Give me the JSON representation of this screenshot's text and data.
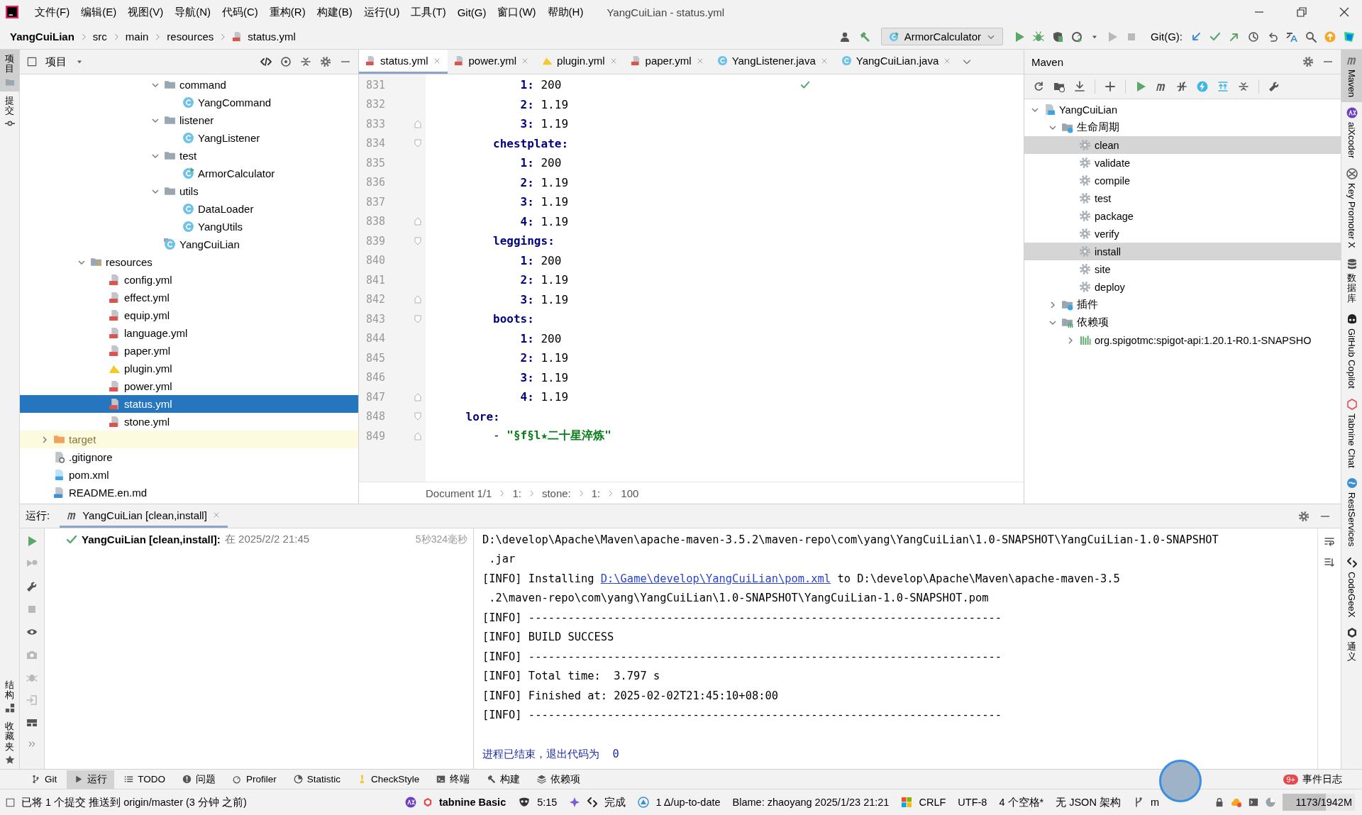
{
  "menu_bar": {
    "items": [
      "文件(F)",
      "编辑(E)",
      "视图(V)",
      "导航(N)",
      "代码(C)",
      "重构(R)",
      "构建(B)",
      "运行(U)",
      "工具(T)",
      "Git(G)",
      "窗口(W)",
      "帮助(H)"
    ],
    "title": "YangCuiLian - status.yml"
  },
  "breadcrumb": [
    {
      "label": "YangCuiLian",
      "kind": "project"
    },
    {
      "label": "src",
      "kind": "folder"
    },
    {
      "label": "main",
      "kind": "folder"
    },
    {
      "label": "resources",
      "kind": "folder"
    },
    {
      "label": "status.yml",
      "kind": "yml"
    }
  ],
  "toolbar": {
    "run_config": "ArmorCalculator",
    "git_label": "Git(G):"
  },
  "left_strip_top": [
    {
      "label": "项目",
      "kind": "project",
      "selected": true
    },
    {
      "label": "提交",
      "kind": "commit",
      "selected": false
    }
  ],
  "left_strip_bottom": [
    {
      "label": "结构",
      "kind": "structure",
      "selected": false
    },
    {
      "label": "收藏夹",
      "kind": "favorites",
      "selected": false
    }
  ],
  "project": {
    "title": "项目",
    "tree": [
      {
        "children": [
          {
            "children": [
              {
                "children": [
                  {
                    "children": [
                      {
                        "children": [
                          {
                            "children": [
                              {
                                "label": "command",
                                "kind": "folder",
                                "expanded": true,
                                "selected": false,
                                "children": [
                                  {
                                    "label": "YangCommand",
                                    "kind": "class",
                                    "selected": false
                                  }
                                ]
                              },
                              {
                                "label": "listener",
                                "kind": "folder",
                                "expanded": true,
                                "selected": false,
                                "children": [
                                  {
                                    "label": "YangListener",
                                    "kind": "class",
                                    "selected": false
                                  }
                                ]
                              },
                              {
                                "label": "test",
                                "kind": "folder",
                                "expanded": true,
                                "selected": false,
                                "children": [
                                  {
                                    "label": "ArmorCalculator",
                                    "kind": "class-runnable",
                                    "selected": false
                                  }
                                ]
                              },
                              {
                                "label": "utils",
                                "kind": "folder",
                                "expanded": true,
                                "selected": false,
                                "children": [
                                  {
                                    "label": "DataLoader",
                                    "kind": "class",
                                    "selected": false
                                  },
                                  {
                                    "label": "YangUtils",
                                    "kind": "class",
                                    "selected": false
                                  }
                                ]
                              },
                              {
                                "label": "YangCuiLian",
                                "kind": "class-main",
                                "selected": false
                              }
                            ]
                          }
                        ]
                      }
                    ]
                  }
                ]
              },
              {
                "label": "resources",
                "kind": "resources-folder",
                "expanded": true,
                "selected": false,
                "children": [
                  {
                    "label": "config.yml",
                    "kind": "yml",
                    "selected": false
                  },
                  {
                    "label": "effect.yml",
                    "kind": "yml",
                    "selected": false
                  },
                  {
                    "label": "equip.yml",
                    "kind": "yml",
                    "selected": false
                  },
                  {
                    "label": "language.yml",
                    "kind": "yml",
                    "selected": false
                  },
                  {
                    "label": "paper.yml",
                    "kind": "yml",
                    "selected": false
                  },
                  {
                    "label": "plugin.yml",
                    "kind": "plugin-yml",
                    "selected": false
                  },
                  {
                    "label": "power.yml",
                    "kind": "yml",
                    "selected": false
                  },
                  {
                    "label": "status.yml",
                    "kind": "yml",
                    "selected": true
                  },
                  {
                    "label": "stone.yml",
                    "kind": "yml",
                    "selected": false
                  }
                ]
              }
            ]
          }
        ]
      },
      {
        "label": "target",
        "kind": "excluded-folder",
        "expanded": false,
        "selected": false
      },
      {
        "label": ".gitignore",
        "kind": "gitignore",
        "selected": false
      },
      {
        "label": "pom.xml",
        "kind": "maven-file",
        "selected": false
      },
      {
        "label": "README.en.md",
        "kind": "markdown",
        "selected": false
      }
    ]
  },
  "editor": {
    "tabs": [
      {
        "label": "status.yml",
        "kind": "yml",
        "selected": true
      },
      {
        "label": "power.yml",
        "kind": "yml",
        "selected": false
      },
      {
        "label": "plugin.yml",
        "kind": "plugin-yml",
        "selected": false
      },
      {
        "label": "paper.yml",
        "kind": "yml",
        "selected": false
      },
      {
        "label": "YangListener.java",
        "kind": "class",
        "selected": false
      },
      {
        "label": "YangCuiLian.java",
        "kind": "class",
        "selected": false
      }
    ],
    "lines": [
      {
        "number": "831",
        "kind": "entry",
        "key": "            1:",
        "value": "200",
        "fold_start": false,
        "fold_end": false
      },
      {
        "number": "832",
        "kind": "entry",
        "key": "            2:",
        "value": "1.19",
        "fold_start": false,
        "fold_end": false
      },
      {
        "number": "833",
        "kind": "entry",
        "key": "            3:",
        "value": "1.19",
        "fold_start": false,
        "fold_end": true
      },
      {
        "number": "834",
        "kind": "section",
        "key": "        chestplate:",
        "fold_start": true,
        "fold_end": false
      },
      {
        "number": "835",
        "kind": "entry",
        "key": "            1:",
        "value": "200",
        "fold_start": false,
        "fold_end": false
      },
      {
        "number": "836",
        "kind": "entry",
        "key": "            2:",
        "value": "1.19",
        "fold_start": false,
        "fold_end": false
      },
      {
        "number": "837",
        "kind": "entry",
        "key": "            3:",
        "value": "1.19",
        "fold_start": false,
        "fold_end": false
      },
      {
        "number": "838",
        "kind": "entry",
        "key": "            4:",
        "value": "1.19",
        "fold_start": false,
        "fold_end": true
      },
      {
        "number": "839",
        "kind": "section",
        "key": "        leggings:",
        "fold_start": true,
        "fold_end": false
      },
      {
        "number": "840",
        "kind": "entry",
        "key": "            1:",
        "value": "200",
        "fold_start": false,
        "fold_end": false
      },
      {
        "number": "841",
        "kind": "entry",
        "key": "            2:",
        "value": "1.19",
        "fold_start": false,
        "fold_end": false
      },
      {
        "number": "842",
        "kind": "entry",
        "key": "            3:",
        "value": "1.19",
        "fold_start": false,
        "fold_end": true
      },
      {
        "number": "843",
        "kind": "section",
        "key": "        boots:",
        "fold_start": true,
        "fold_end": false
      },
      {
        "number": "844",
        "kind": "entry",
        "key": "            1:",
        "value": "200",
        "fold_start": false,
        "fold_end": false
      },
      {
        "number": "845",
        "kind": "entry",
        "key": "            2:",
        "value": "1.19",
        "fold_start": false,
        "fold_end": false
      },
      {
        "number": "846",
        "kind": "entry",
        "key": "            3:",
        "value": "1.19",
        "fold_start": false,
        "fold_end": false
      },
      {
        "number": "847",
        "kind": "entry",
        "key": "            4:",
        "value": "1.19",
        "fold_start": false,
        "fold_end": true
      },
      {
        "number": "848",
        "kind": "section",
        "key": "    lore:",
        "fold_start": true,
        "fold_end": false
      },
      {
        "number": "849",
        "kind": "list-item",
        "key": "        -",
        "value": "\"§f§l★二十星淬炼\"",
        "fold_start": false,
        "fold_end": true
      }
    ],
    "breadcrumb": [
      "Document 1/1",
      "1:",
      "stone:",
      "1:",
      "100"
    ]
  },
  "maven": {
    "title": "Maven",
    "tree": [
      {
        "label": "YangCuiLian",
        "kind": "project",
        "expanded": true,
        "selected": false,
        "children": [
          {
            "label": "生命周期",
            "kind": "lifecycle",
            "expanded": true,
            "selected": false,
            "children": [
              {
                "label": "clean",
                "kind": "goal",
                "selected": true
              },
              {
                "label": "validate",
                "kind": "goal",
                "selected": false
              },
              {
                "label": "compile",
                "kind": "goal",
                "selected": false
              },
              {
                "label": "test",
                "kind": "goal",
                "selected": false
              },
              {
                "label": "package",
                "kind": "goal",
                "selected": false
              },
              {
                "label": "verify",
                "kind": "goal",
                "selected": false
              },
              {
                "label": "install",
                "kind": "goal",
                "selected": true
              },
              {
                "label": "site",
                "kind": "goal",
                "selected": false
              },
              {
                "label": "deploy",
                "kind": "goal",
                "selected": false
              }
            ]
          },
          {
            "label": "插件",
            "kind": "plugins",
            "expanded": false,
            "selected": false
          },
          {
            "label": "依赖项",
            "kind": "dependencies",
            "expanded": true,
            "selected": false,
            "children": [
              {
                "label": "org.spigotmc:spigot-api:1.20.1-R0.1-SNAPSHO",
                "kind": "library",
                "expanded": false,
                "selected": false
              }
            ]
          }
        ]
      }
    ]
  },
  "right_strip": [
    {
      "label": "Maven",
      "kind": "maven",
      "selected": true
    },
    {
      "label": "aiXcoder",
      "kind": "aixcoder",
      "selected": false
    },
    {
      "label": "Key Promoter X",
      "kind": "keypromoter",
      "selected": false
    },
    {
      "label": "数据库",
      "kind": "database",
      "selected": false
    },
    {
      "label": "GitHub Copilot",
      "kind": "copilot",
      "selected": false
    },
    {
      "label": "Tabnine Chat",
      "kind": "tabnine",
      "selected": false
    },
    {
      "label": "RestServices",
      "kind": "rest",
      "selected": false
    },
    {
      "label": "CodeGeeX",
      "kind": "codegeex",
      "selected": false
    },
    {
      "label": "通义",
      "kind": "tongyi",
      "selected": false
    }
  ],
  "run": {
    "label": "运行:",
    "tab": "YangCuiLian [clean,install]",
    "result": {
      "name": "YangCuiLian [clean,install]:",
      "time": "在 2025/2/2 21:45",
      "duration": "5秒324毫秒"
    },
    "console": [
      {
        "kind": "text",
        "text": "D:\\develop\\Apache\\Maven\\apache-maven-3.5.2\\maven-repo\\com\\yang\\YangCuiLian\\1.0-SNAPSHOT\\YangCuiLian-1.0-SNAPSHOT"
      },
      {
        "kind": "continuation",
        "text": ".jar"
      },
      {
        "kind": "link",
        "before": "[INFO] Installing",
        "link": "D:\\Game\\develop\\YangCuiLian\\pom.xml",
        "after": "to D:\\develop\\Apache\\Maven\\apache-maven-3.5"
      },
      {
        "kind": "continuation",
        "text": ".2\\maven-repo\\com\\yang\\YangCuiLian\\1.0-SNAPSHOT\\YangCuiLian-1.0-SNAPSHOT.pom"
      },
      {
        "kind": "text",
        "text": "[INFO] ------------------------------------------------------------------------"
      },
      {
        "kind": "text",
        "text": "[INFO] BUILD SUCCESS"
      },
      {
        "kind": "text",
        "text": "[INFO] ------------------------------------------------------------------------"
      },
      {
        "kind": "text",
        "text": "[INFO] Total time:  3.797 s"
      },
      {
        "kind": "text",
        "text": "[INFO] Finished at: 2025-02-02T21:45:10+08:00"
      },
      {
        "kind": "text",
        "text": "[INFO] ------------------------------------------------------------------------"
      },
      {
        "kind": "blank"
      },
      {
        "kind": "exit",
        "text": "进程已结束，退出代码为  0"
      }
    ]
  },
  "tool_windows": [
    {
      "label": "Git",
      "kind": "git",
      "selected": false
    },
    {
      "label": "运行",
      "kind": "run",
      "selected": true
    },
    {
      "label": "TODO",
      "kind": "todo",
      "selected": false
    },
    {
      "label": "问题",
      "kind": "problems",
      "selected": false
    },
    {
      "label": "Profiler",
      "kind": "profiler",
      "selected": false
    },
    {
      "label": "Statistic",
      "kind": "statistic",
      "selected": false
    },
    {
      "label": "CheckStyle",
      "kind": "checkstyle",
      "selected": false
    },
    {
      "label": "终端",
      "kind": "terminal",
      "selected": false
    },
    {
      "label": "构建",
      "kind": "build",
      "selected": false
    },
    {
      "label": "依赖项",
      "kind": "dependencies",
      "selected": false
    }
  ],
  "event_log": {
    "label": "事件日志",
    "badge": "9+"
  },
  "status_bar": {
    "message": "已将 1 个提交 推送到 origin/master (3 分钟 之前)",
    "tabnine": "tabnine",
    "tabnine_plan": "Basic",
    "position": "5:15",
    "codegeex": "完成",
    "vcs": "1 Δ/up-to-date",
    "blame": "Blame: zhaoyang 2025/1/23 21:21",
    "line_separator": "CRLF",
    "encoding": "UTF-8",
    "indent": "4 个空格*",
    "schema": "无 JSON 架构",
    "branch": "m",
    "memory": {
      "text": "1173/1942M",
      "level": 0.6
    }
  }
}
